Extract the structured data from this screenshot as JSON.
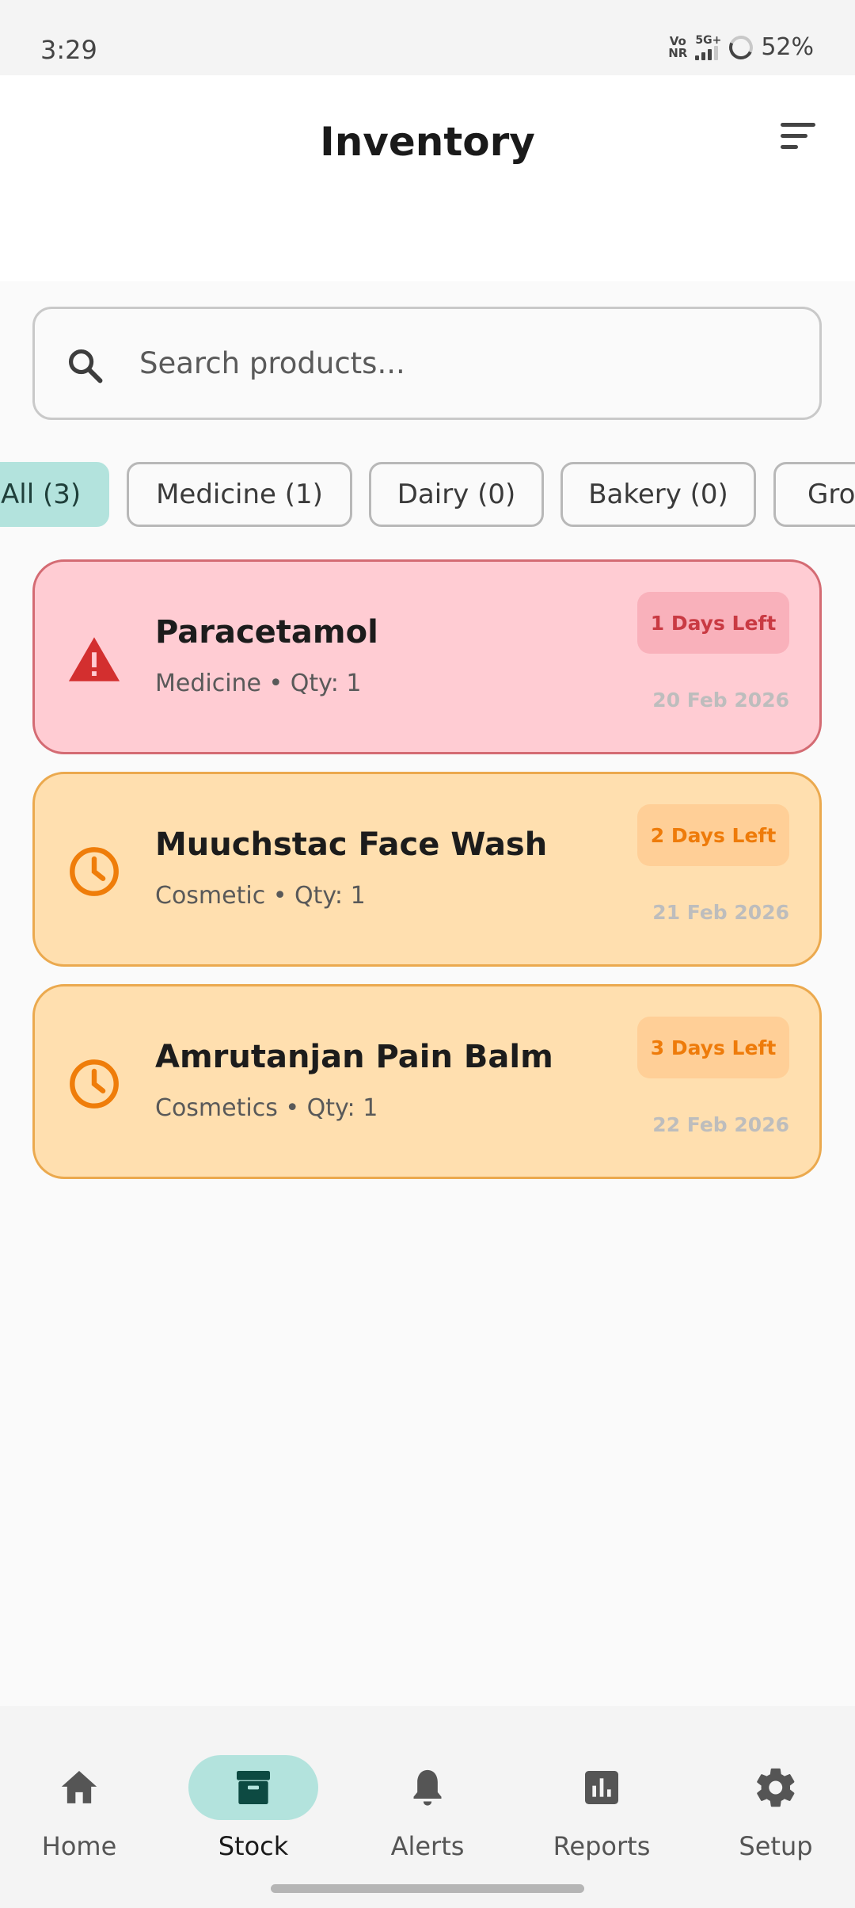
{
  "status_bar": {
    "time": "3:29",
    "network_top": "Vo",
    "network_bottom": "NR",
    "signal_label": "5G+",
    "battery": "52%"
  },
  "header": {
    "title": "Inventory"
  },
  "search": {
    "placeholder": "Search products..."
  },
  "filters": [
    {
      "label": "All (3)",
      "selected": true
    },
    {
      "label": "Medicine (1)",
      "selected": false
    },
    {
      "label": "Dairy (0)",
      "selected": false
    },
    {
      "label": "Bakery (0)",
      "selected": false
    },
    {
      "label": "Groc",
      "selected": false
    }
  ],
  "products": [
    {
      "name": "Paracetamol",
      "category_qty": "Medicine • Qty: 1",
      "badge": "1 Days Left",
      "date": "20 Feb 2026",
      "status": "critical",
      "icon": "warning-icon"
    },
    {
      "name": "Muuchstac Face Wash",
      "category_qty": "Cosmetic • Qty: 1",
      "badge": "2 Days Left",
      "date": "21 Feb 2026",
      "status": "warning",
      "icon": "clock-icon"
    },
    {
      "name": "Amrutanjan Pain Balm",
      "category_qty": "Cosmetics • Qty: 1",
      "badge": "3 Days Left",
      "date": "22 Feb 2026",
      "status": "warning",
      "icon": "clock-icon"
    }
  ],
  "colors": {
    "critical_bg": "#ffccd3",
    "critical_border": "#d46b73",
    "critical_icon": "#d32f2f",
    "warning_bg": "#ffdfaf",
    "warning_border": "#eba94e",
    "warning_icon": "#ef7d0a",
    "accent": "#b3e3dd",
    "accent_dark": "#0d4a42"
  },
  "nav": [
    {
      "label": "Home",
      "icon": "home-icon",
      "active": false
    },
    {
      "label": "Stock",
      "icon": "archive-box-icon",
      "active": true
    },
    {
      "label": "Alerts",
      "icon": "bell-icon",
      "active": false
    },
    {
      "label": "Reports",
      "icon": "bar-chart-icon",
      "active": false
    },
    {
      "label": "Setup",
      "icon": "gear-icon",
      "active": false
    }
  ]
}
